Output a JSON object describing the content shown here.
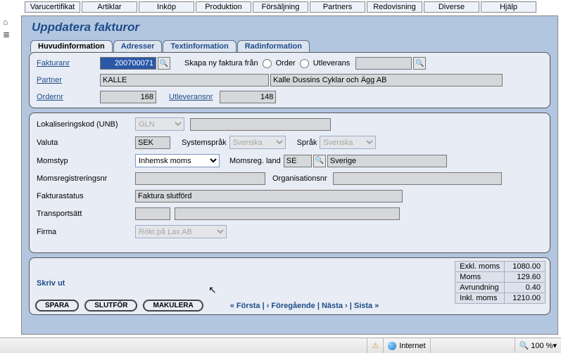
{
  "menu": [
    "Varucertifikat",
    "Artiklar",
    "Inköp",
    "Produktion",
    "Försäljning",
    "Partners",
    "Redovisning",
    "Diverse",
    "Hjälp"
  ],
  "page_title": "Uppdatera fakturor",
  "tabs": [
    "Huvudinformation",
    "Adresser",
    "Textinformation",
    "Radinformation"
  ],
  "top": {
    "fakturanr_label": "Fakturanr",
    "fakturanr": "200700071",
    "skapa_label": "Skapa ny faktura från",
    "order_label": "Order",
    "utleverans_label": "Utleverans",
    "partner_label": "Partner",
    "partner_code": "KALLE",
    "partner_name": "Kalle Dussins Cyklar och Ägg AB",
    "ordernr_label": "Ordernr",
    "ordernr": "168",
    "utleveransnr_label": "Utleveransnr",
    "utleveransnr": "148"
  },
  "mid": {
    "unb_label": "Lokaliseringskod (UNB)",
    "unb_sel": "GLN",
    "valuta_label": "Valuta",
    "valuta": "SEK",
    "systemsprak_label": "Systemspråk",
    "systemsprak": "Svenska",
    "sprak_label": "Språk",
    "sprak": "Svenska",
    "momstyp_label": "Momstyp",
    "momstyp": "Inhemsk moms",
    "momsreg_label": "Momsreg. land",
    "momsreg_code": "SE",
    "momsreg_name": "Sverige",
    "momsregnr_label": "Momsregistreringsnr",
    "orgnr_label": "Organisationsnr",
    "fakturastatus_label": "Fakturastatus",
    "fakturastatus": "Faktura slutförd",
    "transport_label": "Transportsätt",
    "firma_label": "Firma",
    "firma": "Rökt på Lax AB"
  },
  "print_label": "Skriv ut",
  "buttons": {
    "spara": "SPARA",
    "slutfor": "SLUTFÖR",
    "makulera": "MAKULERA"
  },
  "nav": {
    "first": "« Första",
    "prev": "‹ Föregående",
    "next": "Nästa ›",
    "last": "Sista »",
    "sep": " | "
  },
  "totals": [
    {
      "label": "Exkl. moms",
      "val": "1080.00"
    },
    {
      "label": "Moms",
      "val": "129.60"
    },
    {
      "label": "Avrundning",
      "val": "0.40"
    },
    {
      "label": "Inkl. moms",
      "val": "1210.00"
    }
  ],
  "status": {
    "internet": "Internet",
    "zoom": "100 %"
  }
}
